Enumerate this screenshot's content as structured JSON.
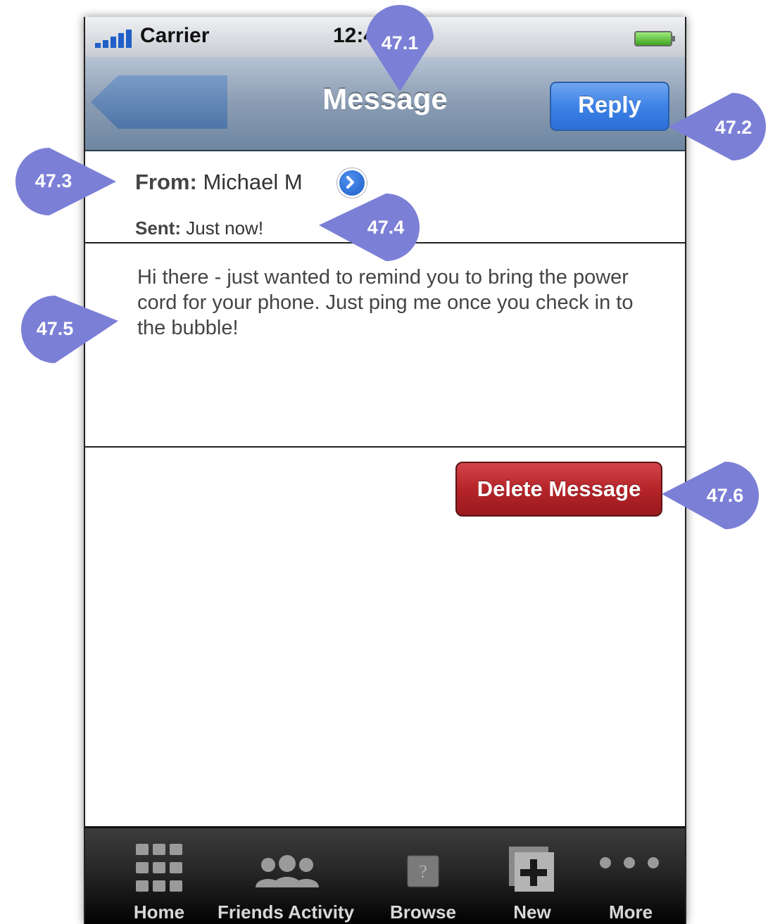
{
  "status_bar": {
    "carrier": "Carrier",
    "time": "12:47 PM"
  },
  "nav_bar": {
    "title": "Message",
    "reply_label": "Reply"
  },
  "message": {
    "from_label": "From:",
    "from_value": "Michael M",
    "sent_label": "Sent:",
    "sent_value": "Just now!",
    "body": "Hi there - just wanted to remind you to bring the power cord for your phone. Just ping me once you check in to the bubble!"
  },
  "actions": {
    "delete_label": "Delete Message"
  },
  "tab_bar": {
    "items": [
      {
        "label": "Home",
        "icon": "grid-icon"
      },
      {
        "label": "Friends Activity",
        "icon": "people-icon"
      },
      {
        "label": "Browse",
        "icon": "question-icon"
      },
      {
        "label": "New",
        "icon": "plus-icon"
      },
      {
        "label": "More",
        "icon": "more-dots-icon"
      }
    ]
  },
  "annotations": [
    "47.1",
    "47.2",
    "47.3",
    "47.4",
    "47.5",
    "47.6"
  ],
  "colors": {
    "accent_blue": "#3d82e6",
    "delete_red": "#b52429",
    "marker": "#7b7fd6"
  }
}
